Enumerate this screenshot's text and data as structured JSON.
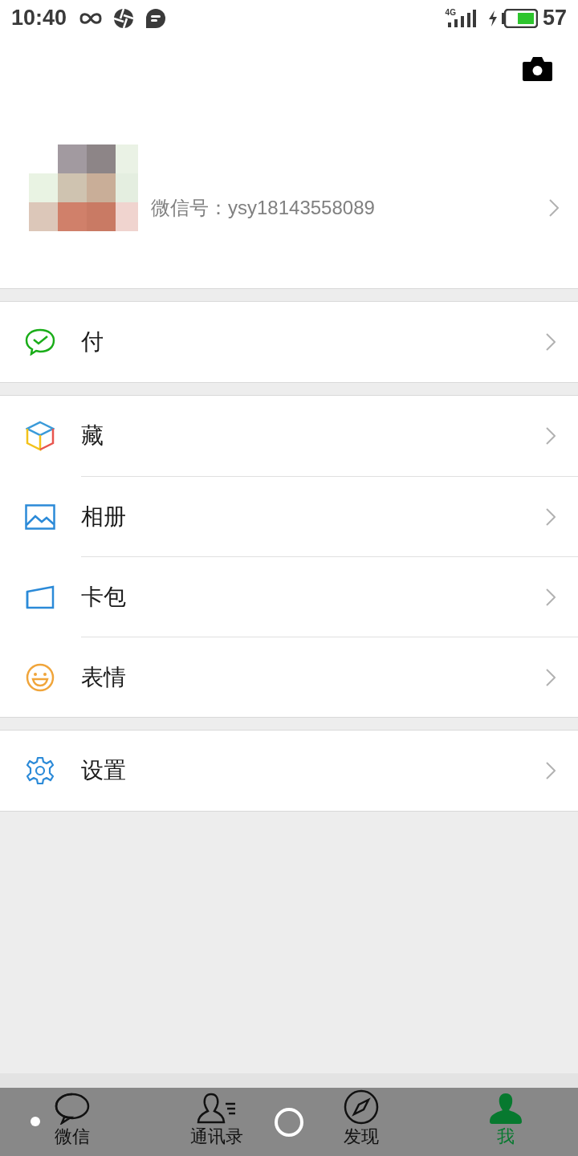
{
  "status_bar": {
    "time": "10:40",
    "network": "4G",
    "battery": "57"
  },
  "profile": {
    "wechat_id": "微信号：ysy18143558089"
  },
  "menu_groups": [
    {
      "items": [
        {
          "label": "付"
        }
      ]
    },
    {
      "items": [
        {
          "label": "藏"
        },
        {
          "label": "相册"
        },
        {
          "label": "卡包"
        },
        {
          "label": "表情"
        }
      ]
    },
    {
      "items": [
        {
          "label": "设置"
        }
      ]
    }
  ],
  "tabs": [
    {
      "label": "微信",
      "selected": false
    },
    {
      "label": "通讯录",
      "selected": false
    },
    {
      "label": "发现",
      "selected": false
    },
    {
      "label": "我",
      "selected": true
    }
  ]
}
